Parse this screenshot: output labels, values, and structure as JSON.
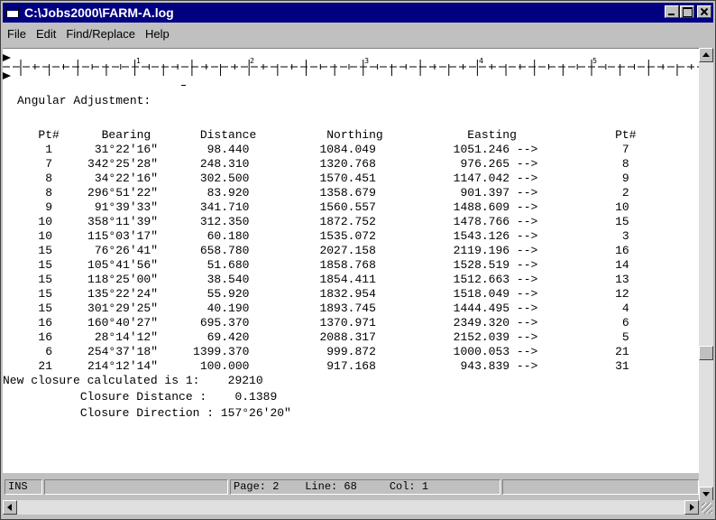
{
  "window": {
    "title": "C:\\Jobs2000\\FARM-A.log"
  },
  "menu": {
    "items": [
      "File",
      "Edit",
      "Find/Replace",
      "Help"
    ]
  },
  "ruler": {
    "numbers": [
      "1",
      "2",
      "3",
      "4",
      "5"
    ]
  },
  "document": {
    "heading": "Angular Adjustment:",
    "table_header": "   Pt#      Bearing       Distance          Northing            Easting              Pt#",
    "rows": [
      "    1      31°22'16\"       98.440          1084.049           1051.246 -->            7",
      "    7     342°25'28\"      248.310          1320.768            976.265 -->            8",
      "    8      34°22'16\"      302.500          1570.451           1147.042 -->            9",
      "    8     296°51'22\"       83.920          1358.679            901.397 -->            2",
      "    9      91°39'33\"      341.710          1560.557           1488.609 -->           10",
      "   10     358°11'39\"      312.350          1872.752           1478.766 -->           15",
      "   10     115°03'17\"       60.180          1535.072           1543.126 -->            3",
      "   15      76°26'41\"      658.780          2027.158           2119.196 -->           16",
      "   15     105°41'56\"       51.680          1858.768           1528.519 -->           14",
      "   15     118°25'00\"       38.540          1854.411           1512.663 -->           13",
      "   15     135°22'24\"       55.920          1832.954           1518.049 -->           12",
      "   15     301°29'25\"       40.190          1893.745           1444.495 -->            4",
      "   16     160°40'27\"      695.370          1370.971           2349.320 -->            6",
      "   16      28°14'12\"       69.420          2088.317           2152.039 -->            5",
      "    6     254°37'18\"     1399.370           999.872           1000.053 -->           21",
      "   21     214°12'14\"      100.000           917.168            943.839 -->           31"
    ],
    "closure": "New closure calculated is 1:    29210",
    "closure_distance": "           Closure Distance :    0.1389",
    "closure_direction": "           Closure Direction : 157°26'20\""
  },
  "status": {
    "mode": "INS",
    "position": "Page: 2    Line: 68     Col: 1"
  },
  "colors": {
    "title_bar": "#000080",
    "chrome": "#c0c0c0",
    "editor_bg": "#ffffff"
  }
}
